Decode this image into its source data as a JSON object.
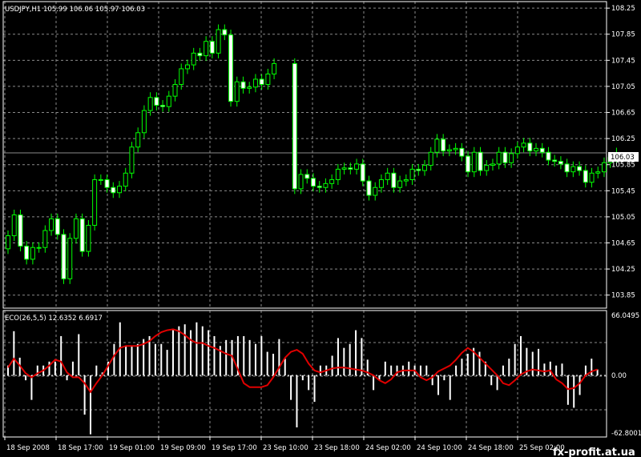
{
  "colors": {
    "background": "#000000",
    "grid": "#8a8a8a",
    "bull_candle": "#00ff00",
    "bear_candle": "#ffffff",
    "histogram": "#ffffff",
    "signal_line": "#e00000",
    "price_line": "#8a8a8a"
  },
  "main": {
    "title": "USDJPY,H1  105.99 106.06 105.97 106.03",
    "current_price_label": "106.03"
  },
  "indicator": {
    "title": "ECO(26,5,5) 12.6352 6.6917",
    "y_labels": [
      "66.0495",
      "0.00",
      "-62.8001"
    ]
  },
  "watermark": "fx-profit.at.ua",
  "chart_data": [
    {
      "type": "candlestick",
      "title": "USDJPY,H1  105.99 106.06 105.97 106.03",
      "ylim": [
        103.65,
        108.35
      ],
      "y_ticks": [
        "108.25",
        "107.85",
        "107.45",
        "107.05",
        "106.65",
        "106.25",
        "105.85",
        "105.45",
        "105.05",
        "104.65",
        "104.25",
        "103.85"
      ],
      "x_ticks": [
        "18 Sep 2008",
        "18 Sep 17:00",
        "19 Sep 01:00",
        "19 Sep 09:00",
        "19 Sep 17:00",
        "23 Sep 10:00",
        "23 Sep 18:00",
        "24 Sep 02:00",
        "24 Sep 10:00",
        "24 Sep 18:00",
        "25 Sep 02:00"
      ],
      "last_price": 106.03,
      "close": [
        104.76,
        105.08,
        104.6,
        104.4,
        104.58,
        104.58,
        104.84,
        105.02,
        104.78,
        104.1,
        104.72,
        105.02,
        104.52,
        104.92,
        105.62,
        105.62,
        105.5,
        105.42,
        105.52,
        105.72,
        106.12,
        106.34,
        106.68,
        106.88,
        106.76,
        106.74,
        106.9,
        107.08,
        107.32,
        107.38,
        107.56,
        107.52,
        107.74,
        107.56,
        107.92,
        107.84,
        106.82,
        107.12,
        107.02,
        107.04,
        107.16,
        107.08,
        107.24,
        107.4,
        105.48,
        105.7,
        105.64,
        105.52,
        105.5,
        105.56,
        105.62,
        105.78,
        105.8,
        105.78,
        105.86,
        105.6,
        105.38,
        105.5,
        105.62,
        105.72,
        105.5,
        105.6,
        105.62,
        105.78,
        105.76,
        105.84,
        106.04,
        106.24,
        106.06,
        106.08,
        106.1,
        105.98,
        105.74,
        106.04,
        105.76,
        105.84,
        105.86,
        106.04,
        105.88,
        106.02,
        106.12,
        106.18,
        106.06,
        106.1,
        106.04,
        105.92,
        105.9,
        105.86,
        105.74,
        105.82,
        105.76,
        105.58,
        105.72,
        105.74,
        105.88,
        105.96,
        106.03
      ]
    },
    {
      "type": "bar",
      "title": "ECO(26,5,5) 12.6352 6.6917",
      "ylim": [
        -62.8001,
        66.0495
      ],
      "histogram": [
        10,
        45,
        18,
        -5,
        -25,
        10,
        10,
        14,
        14,
        40,
        -5,
        14,
        42,
        -40,
        -60,
        10,
        3,
        14,
        32,
        54,
        30,
        30,
        32,
        37,
        40,
        32,
        32,
        26,
        46,
        50,
        52,
        46,
        54,
        50,
        46,
        40,
        30,
        36,
        36,
        40,
        40,
        36,
        32,
        40,
        24,
        22,
        37,
        17,
        -25,
        -53,
        -5,
        -15,
        -27,
        10,
        10,
        20,
        38,
        28,
        32,
        46,
        38,
        16,
        -15,
        -5,
        14,
        10,
        10,
        10,
        14,
        10,
        10,
        10,
        -10,
        -20,
        -5,
        -25,
        10,
        17,
        22,
        28,
        24,
        14,
        -10,
        -15,
        10,
        17,
        32,
        40,
        28,
        24,
        27,
        12,
        14,
        10,
        12,
        -30,
        -33,
        -20,
        10,
        17,
        6
      ],
      "signal": [
        8,
        17,
        10,
        2,
        -2,
        2,
        5,
        10,
        16,
        14,
        3,
        -2,
        -2,
        -8,
        -17,
        -8,
        0,
        10,
        20,
        28,
        30,
        30,
        30,
        32,
        35,
        40,
        44,
        46,
        47,
        45,
        41,
        36,
        33,
        33,
        30,
        28,
        25,
        22,
        20,
        6,
        -8,
        -12,
        -12,
        -12,
        -10,
        -2,
        8,
        18,
        24,
        26,
        22,
        12,
        5,
        3,
        5,
        7,
        8,
        8,
        7,
        6,
        5,
        3,
        0,
        -5,
        -8,
        -4,
        3,
        5,
        5,
        5,
        -2,
        -5,
        -2,
        4,
        7,
        10,
        16,
        23,
        28,
        24,
        18,
        12,
        6,
        0,
        -8,
        -10,
        -5,
        1,
        4,
        6,
        5,
        4,
        5,
        -4,
        -8,
        -14,
        -13,
        -8,
        0,
        4,
        6
      ]
    }
  ]
}
